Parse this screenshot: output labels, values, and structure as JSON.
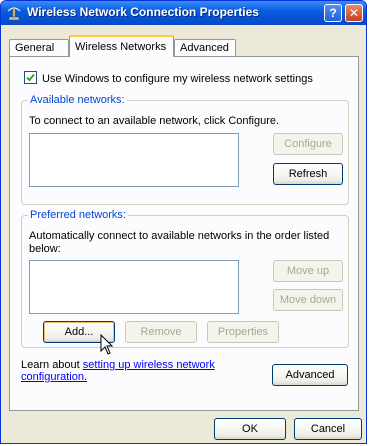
{
  "window": {
    "title": "Wireless Network Connection Properties",
    "help_label": "?",
    "close_label": "✕"
  },
  "tabs": [
    {
      "label": "General",
      "active": false
    },
    {
      "label": "Wireless Networks",
      "active": true
    },
    {
      "label": "Advanced",
      "active": false
    }
  ],
  "settings": {
    "use_windows_label": "Use Windows to configure my wireless network settings",
    "use_windows_checked": true
  },
  "available": {
    "legend": "Available networks:",
    "info": "To connect to an available network, click Configure.",
    "configure_label": "Configure",
    "refresh_label": "Refresh"
  },
  "preferred": {
    "legend": "Preferred networks:",
    "info_line1": "Automatically connect to available networks in the order listed",
    "info_line2": "below:",
    "move_up_label": "Move up",
    "move_down_label": "Move down",
    "add_label": "Add...",
    "remove_label": "Remove",
    "properties_label": "Properties"
  },
  "learn": {
    "prefix": "Learn about ",
    "link_line1": "setting up wireless network",
    "link_line2": "configuration."
  },
  "advanced_label": "Advanced",
  "footer": {
    "ok_label": "OK",
    "cancel_label": "Cancel"
  },
  "colors": {
    "title_gradient_top": "#3a8cf8",
    "title_gradient_bottom": "#0a49c8",
    "group_legend": "#0046d5",
    "link": "#0000ff",
    "dialog_bg": "#ece9d8"
  }
}
